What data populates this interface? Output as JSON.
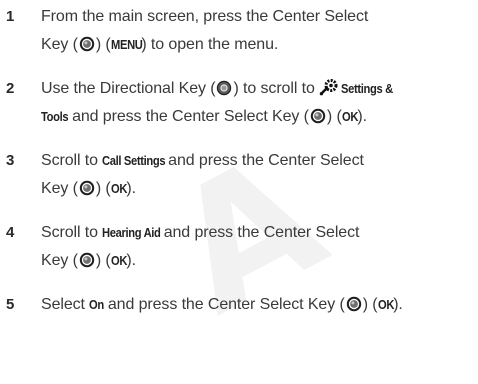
{
  "steps": [
    {
      "number": "1",
      "text": {
        "a": "From the main screen, press the Center Select",
        "b": "Key (",
        "c": ") (",
        "menu": "MENU",
        "d": ") to open the menu."
      }
    },
    {
      "number": "2",
      "text": {
        "a": "Use the Directional Key (",
        "b": ") to scroll to",
        "settings": "Settings &",
        "tools": "Tools",
        "c": "and press the Center Select Key (",
        "d": ") (",
        "ok": "OK",
        "e": ")."
      }
    },
    {
      "number": "3",
      "text": {
        "a": "Scroll to",
        "target": "Call Settings",
        "b": "and press the Center Select",
        "c": "Key (",
        "d": ") (",
        "ok": "OK",
        "e": ")."
      }
    },
    {
      "number": "4",
      "text": {
        "a": "Scroll to",
        "target": "Hearing Aid",
        "b": "and press the Center Select",
        "c": "Key (",
        "d": ") (",
        "ok": "OK",
        "e": ")."
      }
    },
    {
      "number": "5",
      "text": {
        "a": "Select",
        "target": "On",
        "b": "and press the Center Select Key (",
        "c": ") (",
        "ok": "OK",
        "e": ")."
      }
    }
  ],
  "icons": {
    "center_select_key": "center-select-key-icon",
    "directional_key": "directional-key-icon",
    "settings_tools": "settings-tools-gear-icon"
  },
  "watermark": {
    "visible_text": "A"
  },
  "colors": {
    "body_text": "#3a3a3a",
    "step_number": "#2a2a2a",
    "watermark": "#f2f2f2"
  }
}
